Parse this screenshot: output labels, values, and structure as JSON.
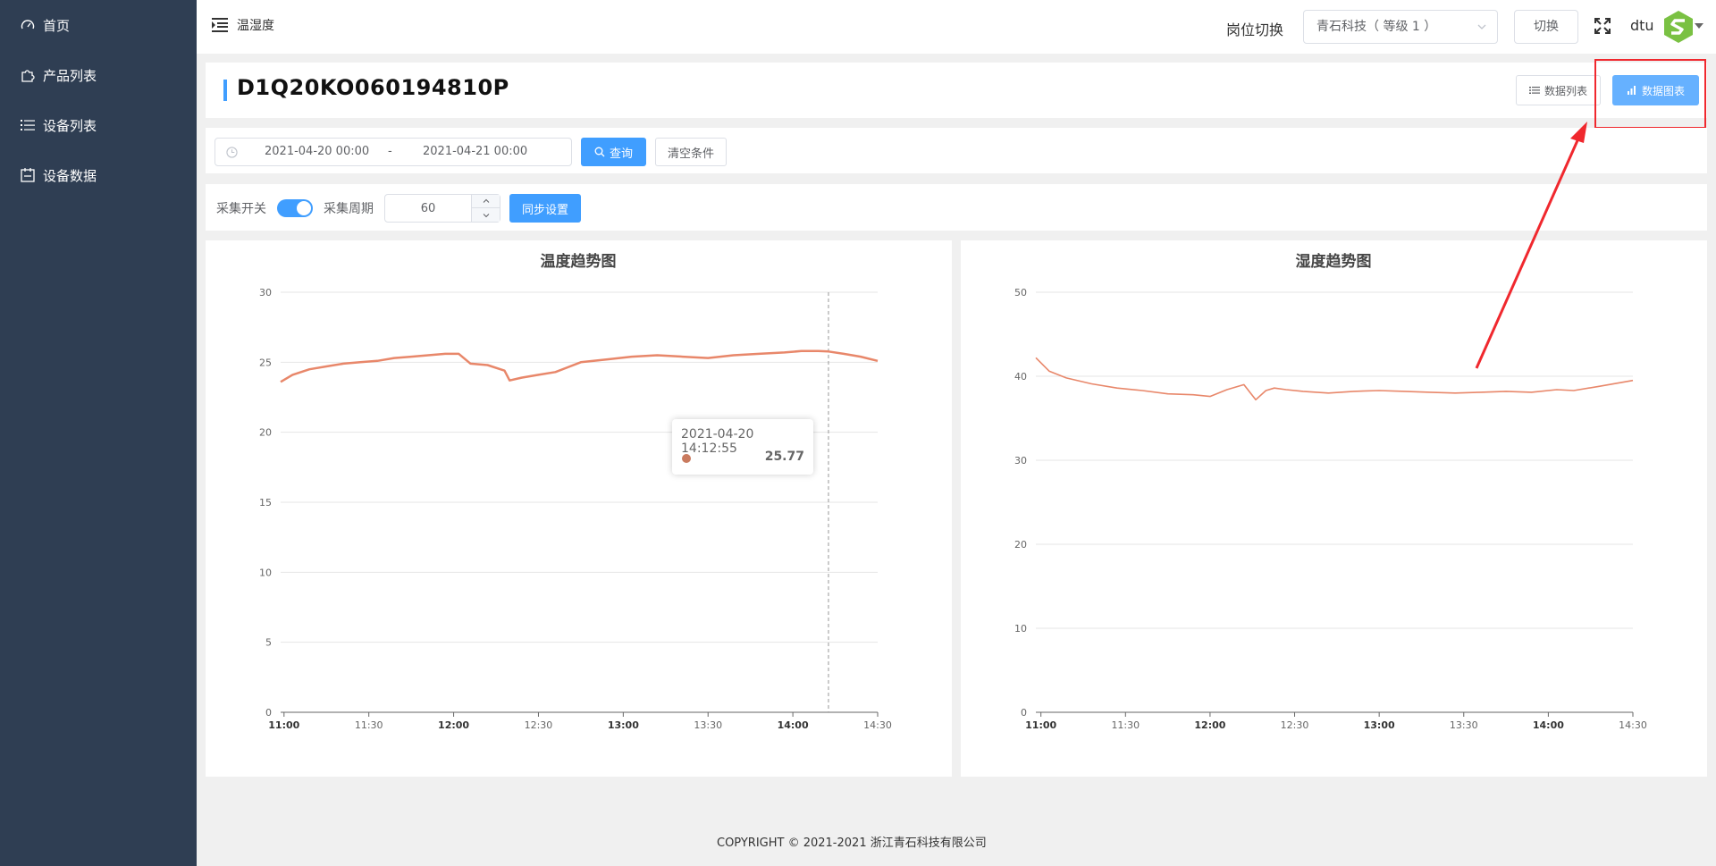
{
  "sidebar": {
    "items": [
      {
        "label": "首页",
        "icon": "dashboard-icon"
      },
      {
        "label": "产品列表",
        "icon": "puzzle-icon"
      },
      {
        "label": "设备列表",
        "icon": "list-icon"
      },
      {
        "label": "设备数据",
        "icon": "calendar-icon"
      }
    ]
  },
  "header": {
    "breadcrumb": "温湿度",
    "role_label": "岗位切换",
    "role_value": "青石科技（ 等级 1 ）",
    "switch_label": "切换",
    "username": "dtu"
  },
  "title_panel": {
    "device_id": "D1Q20KO060194810P",
    "list_button": "数据列表",
    "chart_button": "数据图表"
  },
  "filter": {
    "start": "2021-04-20 00:00",
    "separator": "-",
    "end": "2021-04-21 00:00",
    "query_label": "查询",
    "clear_label": "清空条件"
  },
  "collect": {
    "switch_label": "采集开关",
    "switch_on": true,
    "period_label": "采集周期",
    "period_value": "60",
    "sync_label": "同步设置"
  },
  "colors": {
    "accent": "#409eff",
    "sidebar_bg": "#2f3e53",
    "series": "#e8876a",
    "annotation": "#f0282e"
  },
  "chart_data": [
    {
      "type": "line",
      "title": "温度趋势图",
      "x_ticks": [
        "11:00",
        "11:30",
        "12:00",
        "12:30",
        "13:00",
        "13:30",
        "14:00",
        "14:30"
      ],
      "x_tick_bold": [
        true,
        false,
        true,
        false,
        true,
        false,
        true,
        false
      ],
      "x_range": [
        10.98,
        14.5
      ],
      "ylim": [
        0,
        30
      ],
      "y_ticks": [
        0,
        5,
        10,
        15,
        20,
        25,
        30
      ],
      "grid": true,
      "x": [
        10.98,
        11.05,
        11.15,
        11.25,
        11.35,
        11.45,
        11.55,
        11.65,
        11.75,
        11.85,
        11.95,
        12.03,
        12.1,
        12.2,
        12.3,
        12.33,
        12.4,
        12.5,
        12.6,
        12.75,
        12.9,
        13.05,
        13.2,
        13.35,
        13.5,
        13.65,
        13.8,
        13.95,
        14.05,
        14.15,
        14.21,
        14.3,
        14.4,
        14.5
      ],
      "y": [
        23.6,
        24.1,
        24.5,
        24.7,
        24.9,
        25.0,
        25.1,
        25.3,
        25.4,
        25.5,
        25.6,
        25.6,
        24.9,
        24.8,
        24.4,
        23.7,
        23.9,
        24.1,
        24.3,
        25.0,
        25.2,
        25.4,
        25.5,
        25.4,
        25.3,
        25.5,
        25.6,
        25.7,
        25.8,
        25.8,
        25.77,
        25.6,
        25.4,
        25.1
      ],
      "tooltip": {
        "time": "2021-04-20 14:12:55",
        "value": "25.77",
        "x": 14.21
      }
    },
    {
      "type": "line",
      "title": "湿度趋势图",
      "x_ticks": [
        "11:00",
        "11:30",
        "12:00",
        "12:30",
        "13:00",
        "13:30",
        "14:00",
        "14:30"
      ],
      "x_tick_bold": [
        true,
        false,
        true,
        false,
        true,
        false,
        true,
        false
      ],
      "x_range": [
        10.97,
        14.5
      ],
      "ylim": [
        0,
        50
      ],
      "y_ticks": [
        0,
        10,
        20,
        30,
        40,
        50
      ],
      "grid": true,
      "x": [
        10.97,
        11.05,
        11.15,
        11.3,
        11.45,
        11.6,
        11.75,
        11.9,
        12.0,
        12.1,
        12.2,
        12.27,
        12.33,
        12.38,
        12.45,
        12.55,
        12.7,
        12.85,
        13.0,
        13.15,
        13.3,
        13.45,
        13.6,
        13.75,
        13.9,
        14.05,
        14.15,
        14.3,
        14.5
      ],
      "y": [
        42.2,
        40.6,
        39.8,
        39.1,
        38.6,
        38.3,
        37.9,
        37.8,
        37.6,
        38.4,
        39.0,
        37.2,
        38.3,
        38.6,
        38.4,
        38.2,
        38.0,
        38.2,
        38.3,
        38.2,
        38.1,
        38.0,
        38.1,
        38.2,
        38.1,
        38.4,
        38.3,
        38.8,
        39.5
      ]
    }
  ],
  "footer": "COPYRIGHT © 2021-2021 浙江青石科技有限公司"
}
